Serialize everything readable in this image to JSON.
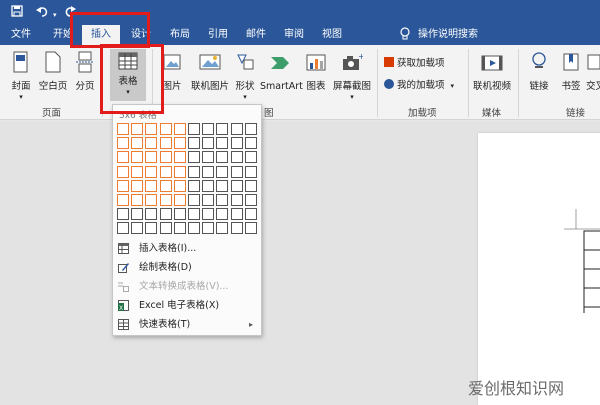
{
  "titlebar": {
    "icons": [
      "save-icon",
      "undo-icon",
      "redo-icon"
    ]
  },
  "menu": {
    "tabs": [
      "文件",
      "开始",
      "插入",
      "设计",
      "布局",
      "引用",
      "邮件",
      "审阅",
      "视图"
    ],
    "active": "插入",
    "tell_me": "操作说明搜索"
  },
  "ribbon": {
    "page_group": {
      "label": "页面",
      "buttons": [
        "封面",
        "空白页",
        "分页"
      ]
    },
    "table_button": "表格",
    "picture_partial": "图片",
    "online_picture": "联机图片",
    "shapes": "形状",
    "smartart": "SmartArt",
    "chart": "图表",
    "screenshot": "屏幕截图",
    "illustrations_label_partial": "图",
    "addins_group": {
      "label": "加载项",
      "get": "获取加载项",
      "mine": "我的加载项"
    },
    "media_group": {
      "label": "媒体",
      "online_video": "联机视频"
    },
    "links_group": {
      "label": "链接",
      "link": "链接",
      "bookmark": "书签",
      "cross_ref_partial": "交叉"
    }
  },
  "dropdown": {
    "title": "5x6 表格",
    "grid": {
      "cols": 10,
      "rows": 8,
      "sel_cols": 5,
      "sel_rows": 6
    },
    "items": [
      {
        "label": "插入表格(I)...",
        "icon": "table-icon",
        "disabled": false
      },
      {
        "label": "绘制表格(D)",
        "icon": "pencil-icon",
        "disabled": false
      },
      {
        "label": "文本转换成表格(V)...",
        "icon": "convert-icon",
        "disabled": true
      },
      {
        "label": "Excel 电子表格(X)",
        "icon": "excel-icon",
        "disabled": false
      },
      {
        "label": "快速表格(T)",
        "icon": "quick-table-icon",
        "disabled": false
      }
    ]
  },
  "watermark": "爱创根知识网",
  "colors": {
    "title_bar": "#2b579a",
    "highlight": "#ed7d31",
    "annotation": "#e21b1b"
  }
}
